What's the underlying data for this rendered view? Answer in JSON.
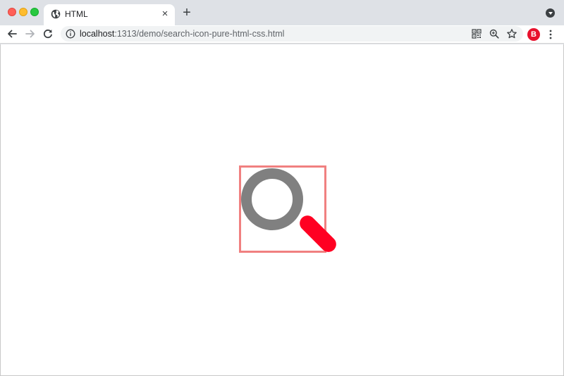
{
  "tab": {
    "title": "HTML",
    "close_glyph": "×",
    "favicon": "globe-icon"
  },
  "tabstrip": {
    "new_tab_glyph": "+"
  },
  "toolbar": {
    "url_host": "localhost",
    "url_path": ":1313/demo/search-icon-pure-html-css.html",
    "profile_initial": "B"
  },
  "colors": {
    "box_border": "#f08080",
    "lens": "#808080",
    "handle": "#ff0022",
    "profile": "#e8112d"
  }
}
